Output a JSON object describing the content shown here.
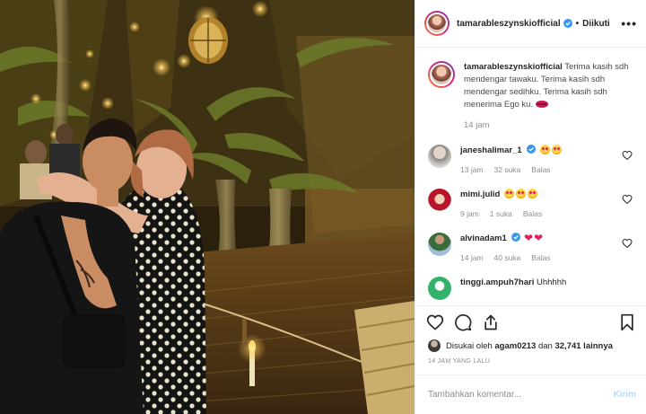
{
  "post": {
    "username": "tamarableszynskiofficial",
    "follow_state": "Diikuti",
    "separator": "•",
    "more": "•••"
  },
  "caption": {
    "username": "tamarableszynskiofficial",
    "text": " Terima kasih sdh mendengar tawaku. Terima kasih sdh mendengar sedihku. Terima kasih sdh menerima Ego ku.",
    "time": "14 jam"
  },
  "comments": [
    {
      "username": "janeshalimar_1",
      "verified": true,
      "time": "13 jam",
      "likes": "32 suka",
      "reply": "Balas",
      "emoji": "heart-eyes-emoji x2"
    },
    {
      "username": "mimi.julid",
      "verified": false,
      "time": "9 jam",
      "likes": "1 suka",
      "reply": "Balas",
      "emoji": "heart-eyes-emoji x3"
    },
    {
      "username": "alvinadam1",
      "verified": true,
      "time": "14 jam",
      "likes": "40 suka",
      "reply": "Balas",
      "emoji": "red-heart-emoji x2"
    },
    {
      "username": "tinggi.ampuh7hari",
      "text": "Uhhhhh"
    }
  ],
  "likes": {
    "prefix": "Disukai oleh ",
    "user": "agam0213",
    "middle": " dan ",
    "count": "32,741 lainnya"
  },
  "post_time": "14 JAM YANG LALU",
  "comment_box": {
    "placeholder": "Tambahkan komentar...",
    "post_label": "Kirim"
  },
  "colors": {
    "accent_blue": "#3897f0",
    "disabled_blue": "#b2dffc",
    "muted_text": "#8e8e8e",
    "primary_text": "#262626",
    "heart_red": "#e0245e"
  },
  "icons": [
    "heart-icon",
    "comment-icon",
    "share-icon",
    "bookmark-icon",
    "verified-badge-icon",
    "more-options-icon"
  ]
}
